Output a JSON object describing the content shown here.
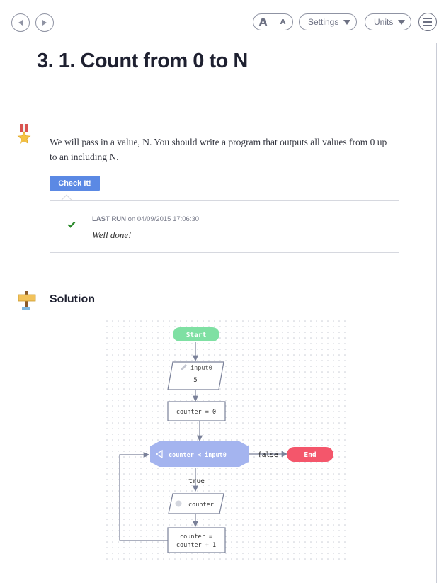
{
  "nav": {
    "back_icon": "arrow-left-icon",
    "forward_icon": "arrow-right-icon",
    "font_larger": "A",
    "font_smaller": "A",
    "settings_label": "Settings",
    "units_label": "Units",
    "menu_icon": "hamburger-menu-icon"
  },
  "page": {
    "title": "3. 1. Count from 0 to N"
  },
  "task": {
    "badge_icon": "medal-icon",
    "description": "We will pass in a value, N. You should write a program that outputs all values from 0 up to an including N.",
    "check_label": "Check It!"
  },
  "last_run": {
    "label": "LAST RUN",
    "on_text": "on 04/09/2015 17:06:30",
    "message": "Well done!",
    "status_icon": "checkmark-icon"
  },
  "solution": {
    "icon": "signpost-icon",
    "title": "Solution"
  },
  "flowchart": {
    "start": "Start",
    "input_name": "input0",
    "input_value": "5",
    "init": "counter = 0",
    "condition": "counter < input0",
    "false_label": "false",
    "true_label": "true",
    "end": "End",
    "output": "counter",
    "increment_line1": "counter =",
    "increment_line2": "counter + 1"
  },
  "colors": {
    "accent_button": "#5b89e4",
    "start_node": "#7fe0a3",
    "end_node": "#f4566b",
    "decision_node": "#a4b4ef",
    "success_check": "#2e8b2e"
  }
}
